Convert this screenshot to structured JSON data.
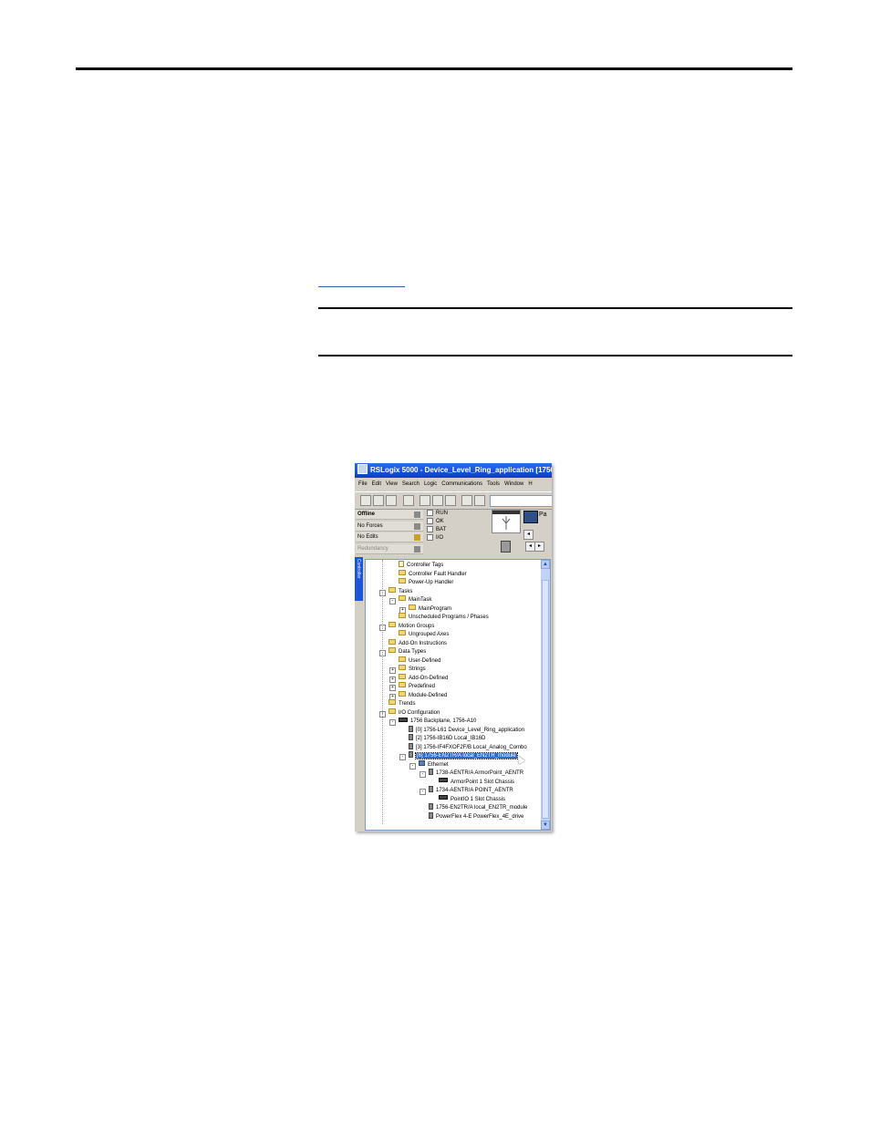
{
  "window": {
    "title": "RSLogix 5000 - Device_Level_Ring_application [1756-",
    "menu": [
      "File",
      "Edit",
      "View",
      "Search",
      "Logic",
      "Communications",
      "Tools",
      "Window",
      "H"
    ],
    "toolbar_icons": [
      "new-icon",
      "open-icon",
      "save-icon",
      "print-icon",
      "cut-icon",
      "copy-icon",
      "paste-icon",
      "undo-icon",
      "redo-icon"
    ]
  },
  "status": {
    "rows": [
      {
        "label": "Offline",
        "bold": true
      },
      {
        "label": "No Forces"
      },
      {
        "label": "No Edits"
      },
      {
        "label": "Redundancy"
      }
    ],
    "leds": [
      "RUN",
      "OK",
      "BAT",
      "I/O"
    ],
    "nav_label": "Pa"
  },
  "side_tab": "Controller",
  "tree": [
    {
      "label": "Controller Tags",
      "icon": "tags",
      "level": 2
    },
    {
      "label": "Controller Fault Handler",
      "icon": "folder",
      "level": 2
    },
    {
      "label": "Power-Up Handler",
      "icon": "folder",
      "level": 2
    },
    {
      "label": "Tasks",
      "icon": "folder",
      "level": 1,
      "exp": "-"
    },
    {
      "label": "MainTask",
      "icon": "folder",
      "level": 2,
      "exp": "-"
    },
    {
      "label": "MainProgram",
      "icon": "folder",
      "level": 3,
      "exp": "+"
    },
    {
      "label": "Unscheduled Programs / Phases",
      "icon": "folder",
      "level": 2
    },
    {
      "label": "Motion Groups",
      "icon": "folder",
      "level": 1,
      "exp": "-"
    },
    {
      "label": "Ungrouped Axes",
      "icon": "folder",
      "level": 2
    },
    {
      "label": "Add-On Instructions",
      "icon": "folder",
      "level": 1
    },
    {
      "label": "Data Types",
      "icon": "folder",
      "level": 1,
      "exp": "-"
    },
    {
      "label": "User-Defined",
      "icon": "folder",
      "level": 2
    },
    {
      "label": "Strings",
      "icon": "folder",
      "level": 2,
      "exp": "+"
    },
    {
      "label": "Add-On-Defined",
      "icon": "folder",
      "level": 2,
      "exp": "+"
    },
    {
      "label": "Predefined",
      "icon": "folder",
      "level": 2,
      "exp": "+"
    },
    {
      "label": "Module-Defined",
      "icon": "folder",
      "level": 2,
      "exp": "+"
    },
    {
      "label": "Trends",
      "icon": "folder",
      "level": 1
    },
    {
      "label": "I/O Configuration",
      "icon": "folder",
      "level": 1,
      "exp": "-"
    },
    {
      "label": "1756 Backplane, 1756-A10",
      "icon": "chassis",
      "level": 2,
      "exp": "-"
    },
    {
      "label": "[0] 1756-L61 Device_Level_Ring_application",
      "icon": "module",
      "level": 3
    },
    {
      "label": "[2] 1756-IB16D Local_IB16D",
      "icon": "module",
      "level": 3
    },
    {
      "label": "[3] 1756-IF4FXOF2F/B Local_Analog_Combo",
      "icon": "module",
      "level": 3
    },
    {
      "label": "[6] 1756-EN2TR/A local_EN2TR_module",
      "icon": "module",
      "level": 3,
      "exp": "-",
      "selected": true
    },
    {
      "label": "Ethernet",
      "icon": "net",
      "level": 4,
      "exp": "-"
    },
    {
      "label": "1738-AENTR/A ArmorPoint_AENTR",
      "icon": "module",
      "level": 5,
      "exp": "-"
    },
    {
      "label": "ArmorPoint 1 Slot Chassis",
      "icon": "chassis",
      "level": 6
    },
    {
      "label": "1734-AENTR/A POINT_AENTR",
      "icon": "module",
      "level": 5,
      "exp": "-"
    },
    {
      "label": "PointIO 1 Slot Chassis",
      "icon": "chassis",
      "level": 6
    },
    {
      "label": "1756-EN2TR/A local_EN2TR_module",
      "icon": "module",
      "level": 5
    },
    {
      "label": "PowerFlex 4-E PowerFlex_4E_drive",
      "icon": "module",
      "level": 5
    }
  ]
}
